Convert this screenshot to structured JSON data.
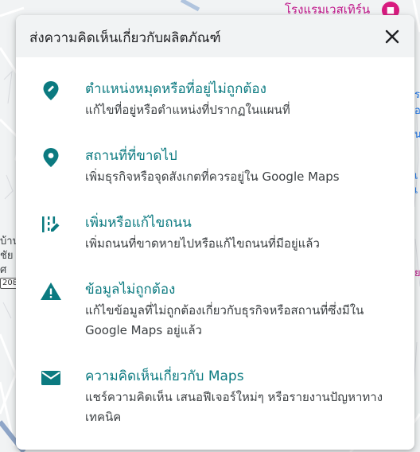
{
  "map": {
    "poi_label": "โรงแรมเวสเทิร์น",
    "left_labels": [
      "บ้าน",
      "ชัย",
      "ศ"
    ],
    "right_labels": [
      "ร",
      "อ",
      "น",
      "เ",
      "เ"
    ],
    "road_number": "208",
    "right_edge_pink": "ย"
  },
  "dialog": {
    "title": "ส่งความคิดเห็นเกี่ยวกับผลิตภัณฑ์",
    "close_icon": "close-icon"
  },
  "options": [
    {
      "icon": "pin-edit-icon",
      "title": "ตำแหน่งหมุดหรือที่อยู่ไม่ถูกต้อง",
      "description": "แก้ไขที่อยู่หรือตำแหน่งที่ปรากฏในแผนที่"
    },
    {
      "icon": "place-pin-icon",
      "title": "สถานที่ที่ขาดไป",
      "description": "เพิ่มธุรกิจหรือจุดสังเกตที่ควรอยู่ใน Google Maps"
    },
    {
      "icon": "road-edit-icon",
      "title": "เพิ่มหรือแก้ไขถนน",
      "description": "เพิ่มถนนที่ขาดหายไปหรือแก้ไขถนนที่มีอยู่แล้ว"
    },
    {
      "icon": "warning-icon",
      "title": "ข้อมูลไม่ถูกต้อง",
      "description": "แก้ไขข้อมูลที่ไม่ถูกต้องเกี่ยวกับธุรกิจหรือสถานที่ซึ่งมีใน Google Maps อยู่แล้ว"
    },
    {
      "icon": "mail-icon",
      "title": "ความคิดเห็นเกี่ยวกับ Maps",
      "description": "แชร์ความคิดเห็น เสนอฟีเจอร์ใหม่ๆ หรือรายงานปัญหาทางเทคนิค"
    }
  ],
  "colors": {
    "accent": "#0b7a80",
    "header_bg": "#f1f3f4",
    "poi": "#c0168a"
  }
}
